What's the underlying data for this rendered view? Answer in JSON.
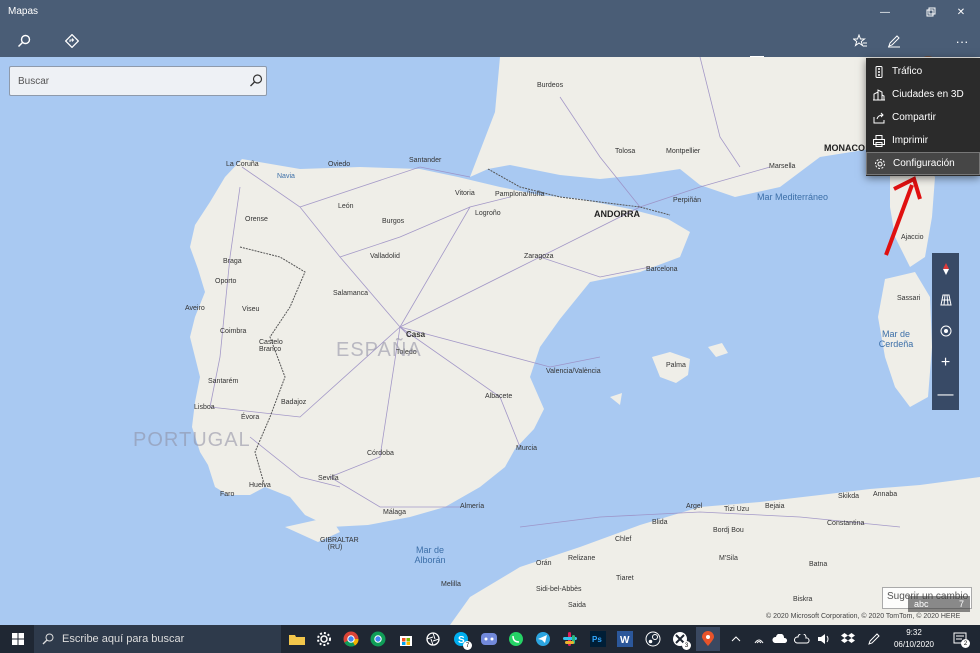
{
  "window": {
    "title": "Mapas"
  },
  "toolbar": {
    "map_style": "Carretera"
  },
  "search": {
    "placeholder": "Buscar"
  },
  "menu": {
    "items": [
      {
        "label": "Tráfico",
        "icon": "traffic-light-icon"
      },
      {
        "label": "Ciudades en 3D",
        "icon": "city-3d-icon"
      },
      {
        "label": "Compartir",
        "icon": "share-icon"
      },
      {
        "label": "Imprimir",
        "icon": "print-icon"
      },
      {
        "label": "Configuración",
        "icon": "settings-gear-icon"
      }
    ]
  },
  "map": {
    "countries": [
      "ESPAÑA",
      "PORTUGAL",
      "ANDORRA",
      "MONACO"
    ],
    "seas": [
      "Mar Mediterráneo",
      "Mar de Alborán",
      "Mar de Cerdeña"
    ],
    "cities": [
      "Burdeos",
      "Tolosa",
      "Montpellier",
      "Marsella",
      "Perpiñán",
      "La Coruña",
      "Oviedo",
      "Santander",
      "Navia",
      "León",
      "Vitoria",
      "Pamplona/Iruña",
      "Logroño",
      "Burgos",
      "Orense",
      "Braga",
      "Oporto",
      "Valladolid",
      "Zaragoza",
      "Barcelona",
      "Aveiro",
      "Viseu",
      "Salamanca",
      "Coimbra",
      "Castelo Branco",
      "Casa",
      "Toledo",
      "Palma",
      "Valencia/València",
      "Santarém",
      "Lisboa",
      "Badajoz",
      "Évora",
      "Albacete",
      "Córdoba",
      "Murcia",
      "Huelva",
      "Faro",
      "Sevilla",
      "Málaga",
      "Almería",
      "GIBRALTAR (RU)",
      "Melilla",
      "Orán",
      "Argel",
      "Tizi Uzu",
      "Bejaia",
      "Skikda",
      "Annaba",
      "Blida",
      "Bordj Bou",
      "Chlef",
      "Relizane",
      "Sidi-bel-Abbès",
      "Tiaret",
      "Saida",
      "M'Sila",
      "Batna",
      "Biskra",
      "Constantina",
      "Ajaccio",
      "Sassari"
    ],
    "suggest": "Sugerir un cambio",
    "copyright": "© 2020 Microsoft Corporation, © 2020 TomTom, © 2020 HERE"
  },
  "taskbar": {
    "search_placeholder": "Escribe aquí para buscar",
    "time": "9:32",
    "date": "06/10/2020",
    "notification_count": "2",
    "skype_badge": "7",
    "xbox_badge": "3",
    "keyboard_hint": "abc",
    "keyboard_number": "7"
  }
}
